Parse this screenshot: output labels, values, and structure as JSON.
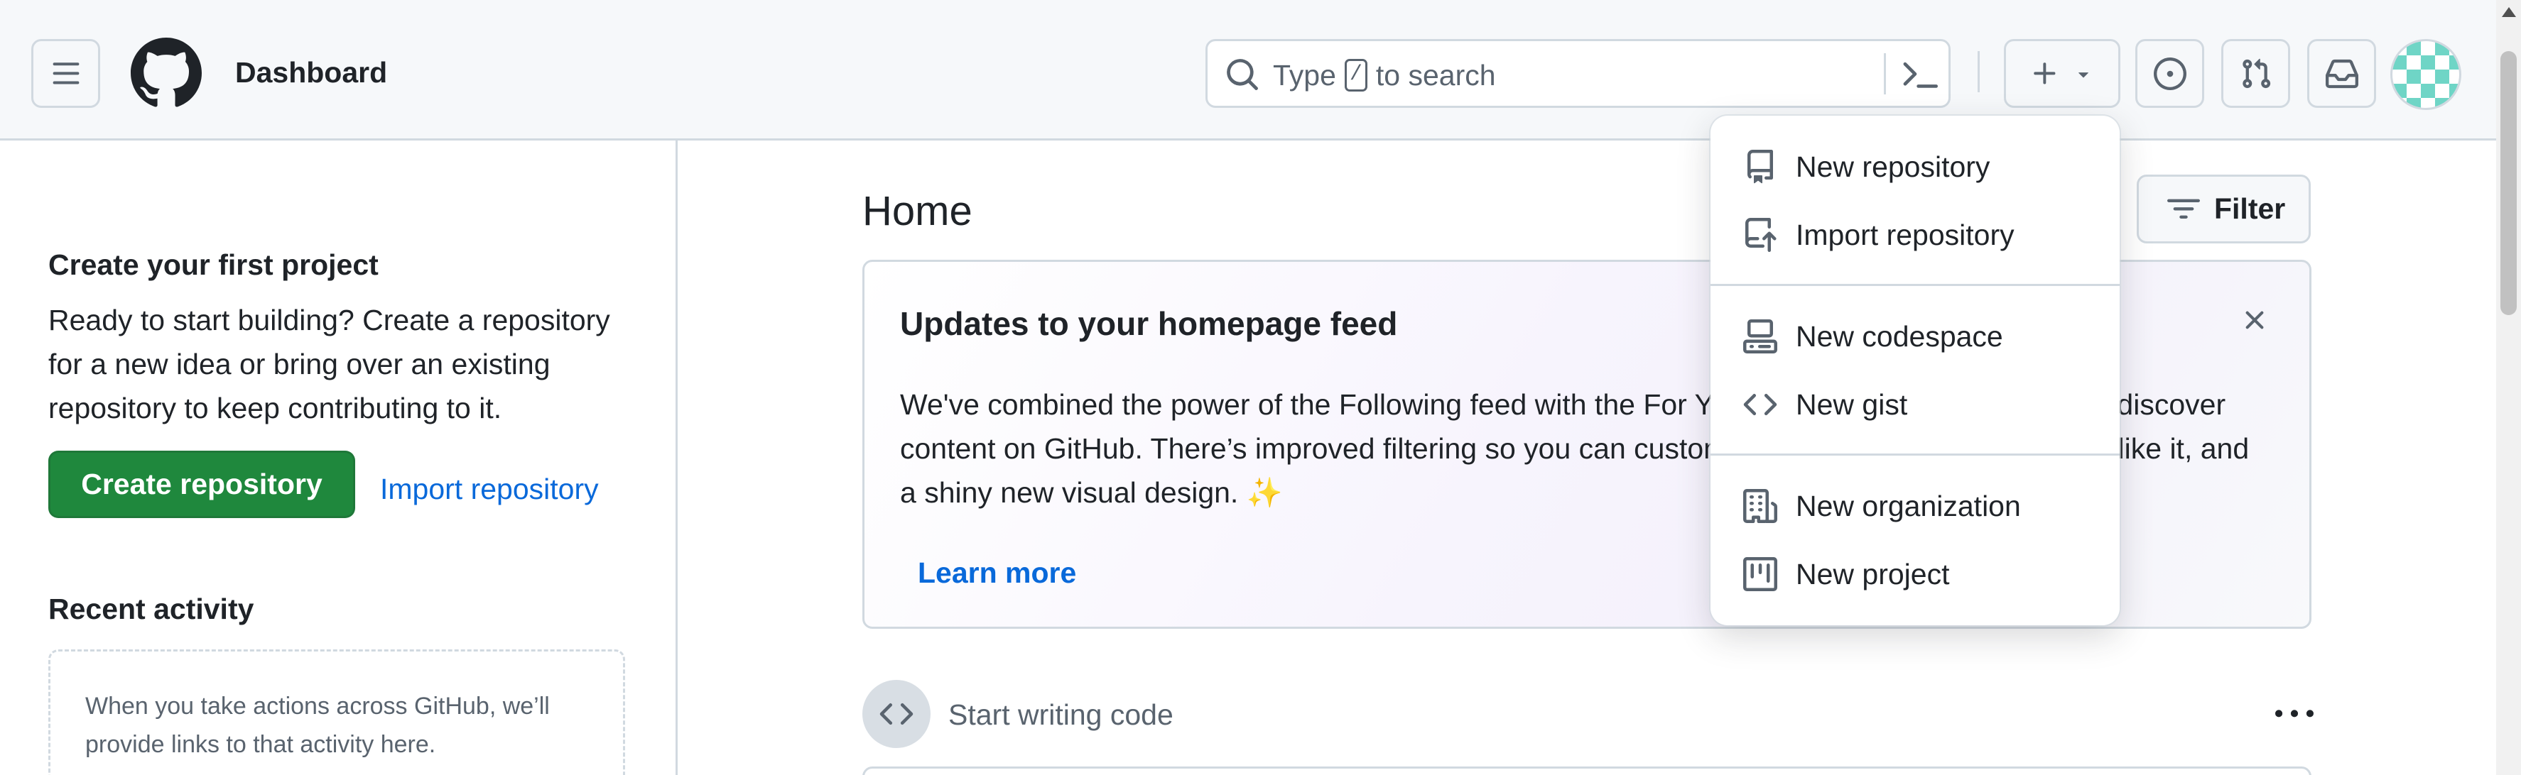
{
  "header": {
    "title": "Dashboard",
    "search_prefix": "Type",
    "search_key": "/",
    "search_suffix": "to search"
  },
  "sidebar": {
    "project_heading": "Create your first project",
    "project_description": "Ready to start building? Create a repository for a new idea or bring over an existing repository to keep contributing to it.",
    "create_button": "Create repository",
    "import_link": "Import repository",
    "recent_heading": "Recent activity",
    "recent_empty_text": "When you take actions across GitHub, we’ll provide links to that activity here."
  },
  "main": {
    "title": "Home",
    "filter_label": "Filter",
    "feed_card": {
      "title": "Updates to your homepage feed",
      "body": "We've combined the power of the Following feed with the For You feed so there’s one place to discover content on GitHub. There’s improved filtering so you can customize your feed exactly how you like it, and a shiny new visual design. ✨",
      "link": "Learn more"
    },
    "start_writing": "Start writing code"
  },
  "create_menu": {
    "items": [
      {
        "label": "New repository",
        "icon": "repo-icon"
      },
      {
        "label": "Import repository",
        "icon": "repo-push-icon"
      },
      {
        "label": "New codespace",
        "icon": "codespaces-icon"
      },
      {
        "label": "New gist",
        "icon": "code-icon"
      },
      {
        "label": "New organization",
        "icon": "organization-icon"
      },
      {
        "label": "New project",
        "icon": "project-icon"
      }
    ]
  },
  "colors": {
    "primary_button": "#1f883d",
    "link": "#0969da",
    "border": "#d1d9e0",
    "header_bg": "#f6f8fa"
  }
}
